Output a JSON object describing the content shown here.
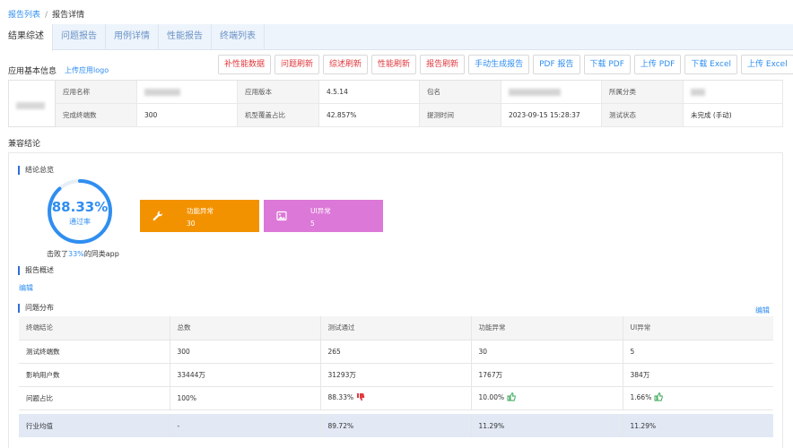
{
  "breadcrumb": {
    "parent": "报告列表",
    "separator": "/",
    "current": "报告详情"
  },
  "tabs": [
    {
      "label": "结果综述",
      "active": true
    },
    {
      "label": "问题报告",
      "active": false
    },
    {
      "label": "用例详情",
      "active": false
    },
    {
      "label": "性能报告",
      "active": false
    },
    {
      "label": "终端列表",
      "active": false
    }
  ],
  "app_info": {
    "title": "应用基本信息",
    "upload_logo": "上传应用logo"
  },
  "toolbar": {
    "buttons": [
      {
        "label": "补性能数据",
        "color": "#e0393e"
      },
      {
        "label": "问题刷新",
        "color": "#e0393e"
      },
      {
        "label": "综述刷新",
        "color": "#e0393e"
      },
      {
        "label": "性能刷新",
        "color": "#e0393e"
      },
      {
        "label": "报告刷新",
        "color": "#e0393e"
      },
      {
        "label": "手动生成报告",
        "color": "#2f8ef0"
      },
      {
        "label": "PDF 报告",
        "color": "#2f8ef0"
      },
      {
        "label": "下载 PDF",
        "color": "#2f8ef0"
      },
      {
        "label": "上传 PDF",
        "color": "#2f8ef0"
      },
      {
        "label": "下载 Excel",
        "color": "#2f8ef0"
      },
      {
        "label": "上传 Excel",
        "color": "#2f8ef0"
      }
    ]
  },
  "info_table": {
    "app_name_label": "应用名称",
    "app_name_value": "",
    "app_version_label": "应用版本",
    "app_version_value": "4.5.14",
    "package_label": "包名",
    "package_value": "",
    "category_label": "所属分类",
    "category_value": "",
    "terminals_label": "完成终端数",
    "terminals_value": "300",
    "coverage_label": "机型覆盖占比",
    "coverage_value": "42.857%",
    "submit_time_label": "提测时间",
    "submit_time_value": "2023-09-15 15:28:37",
    "status_label": "测试状态",
    "status_value": "未完成 (手动)"
  },
  "compat": {
    "title": "兼容结论",
    "summary_title": "结论总览",
    "pass_rate": "88.33%",
    "pass_rate_fraction": 0.8833,
    "pass_label": "通过率",
    "beat_prefix": "击败了",
    "beat_value": "33%",
    "beat_suffix": "的同类app",
    "cards": {
      "func": {
        "title": "功能异常",
        "value": "30",
        "color": "#f39200",
        "icon": "wrench-icon"
      },
      "ui": {
        "title": "UI异常",
        "value": "5",
        "color": "#dc78d7",
        "icon": "image-icon"
      }
    },
    "overview_title": "报告概述",
    "overview_edit": "编辑",
    "dist_title": "问题分布",
    "dist_edit": "编辑",
    "ring_color": "#2f8ef0"
  },
  "distribution": {
    "headers": [
      "终端结论",
      "总数",
      "测试通过",
      "功能异常",
      "UI异常"
    ],
    "rows": [
      [
        "测试终端数",
        "300",
        "265",
        "30",
        "5"
      ],
      [
        "影响用户数",
        "33444万",
        "31293万",
        "1767万",
        "384万"
      ],
      [
        "问题占比",
        "100%",
        "88.33%",
        "10.00%",
        "1.66%"
      ]
    ],
    "avg_row": [
      "行业均值",
      "-",
      "89.72%",
      "11.29%",
      "11.29%"
    ],
    "thumbs": {
      "pass": "thumbs-down-icon",
      "func": "thumbs-up-icon",
      "ui": "thumbs-up-icon"
    }
  }
}
